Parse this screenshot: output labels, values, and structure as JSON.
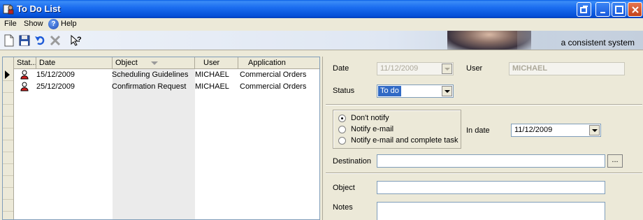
{
  "window": {
    "title": "To Do List"
  },
  "menu": {
    "file": "File",
    "show": "Show",
    "help": "Help"
  },
  "toolbar": {
    "tagline": "a consistent system",
    "icons": [
      "new-icon",
      "save-icon",
      "undo-icon",
      "delete-icon",
      "context-help-icon"
    ]
  },
  "list": {
    "columns": {
      "status": "Stat...",
      "date": "Date",
      "object": "Object",
      "user": "User",
      "application": "Application"
    },
    "rows": [
      {
        "date": "15/12/2009",
        "object": "Scheduling Guidelines",
        "user": "MICHAEL",
        "application": "Commercial Orders"
      },
      {
        "date": "25/12/2009",
        "object": "Confirmation Request",
        "user": "MICHAEL",
        "application": "Commercial Orders"
      }
    ]
  },
  "form": {
    "date_label": "Date",
    "date_value": "11/12/2009",
    "user_label": "User",
    "user_value": "MICHAEL",
    "status_label": "Status",
    "status_value": "To do",
    "notify_options": [
      "Don't notify",
      "Notify e-mail",
      "Notify e-mail and complete task"
    ],
    "notify_selected": "Don't notify",
    "in_date_label": "In date",
    "in_date_value": "11/12/2009",
    "destination_label": "Destination",
    "destination_value": "",
    "browse_label": "...",
    "object_label": "Object",
    "object_value": "",
    "notes_label": "Notes",
    "notes_value": ""
  }
}
